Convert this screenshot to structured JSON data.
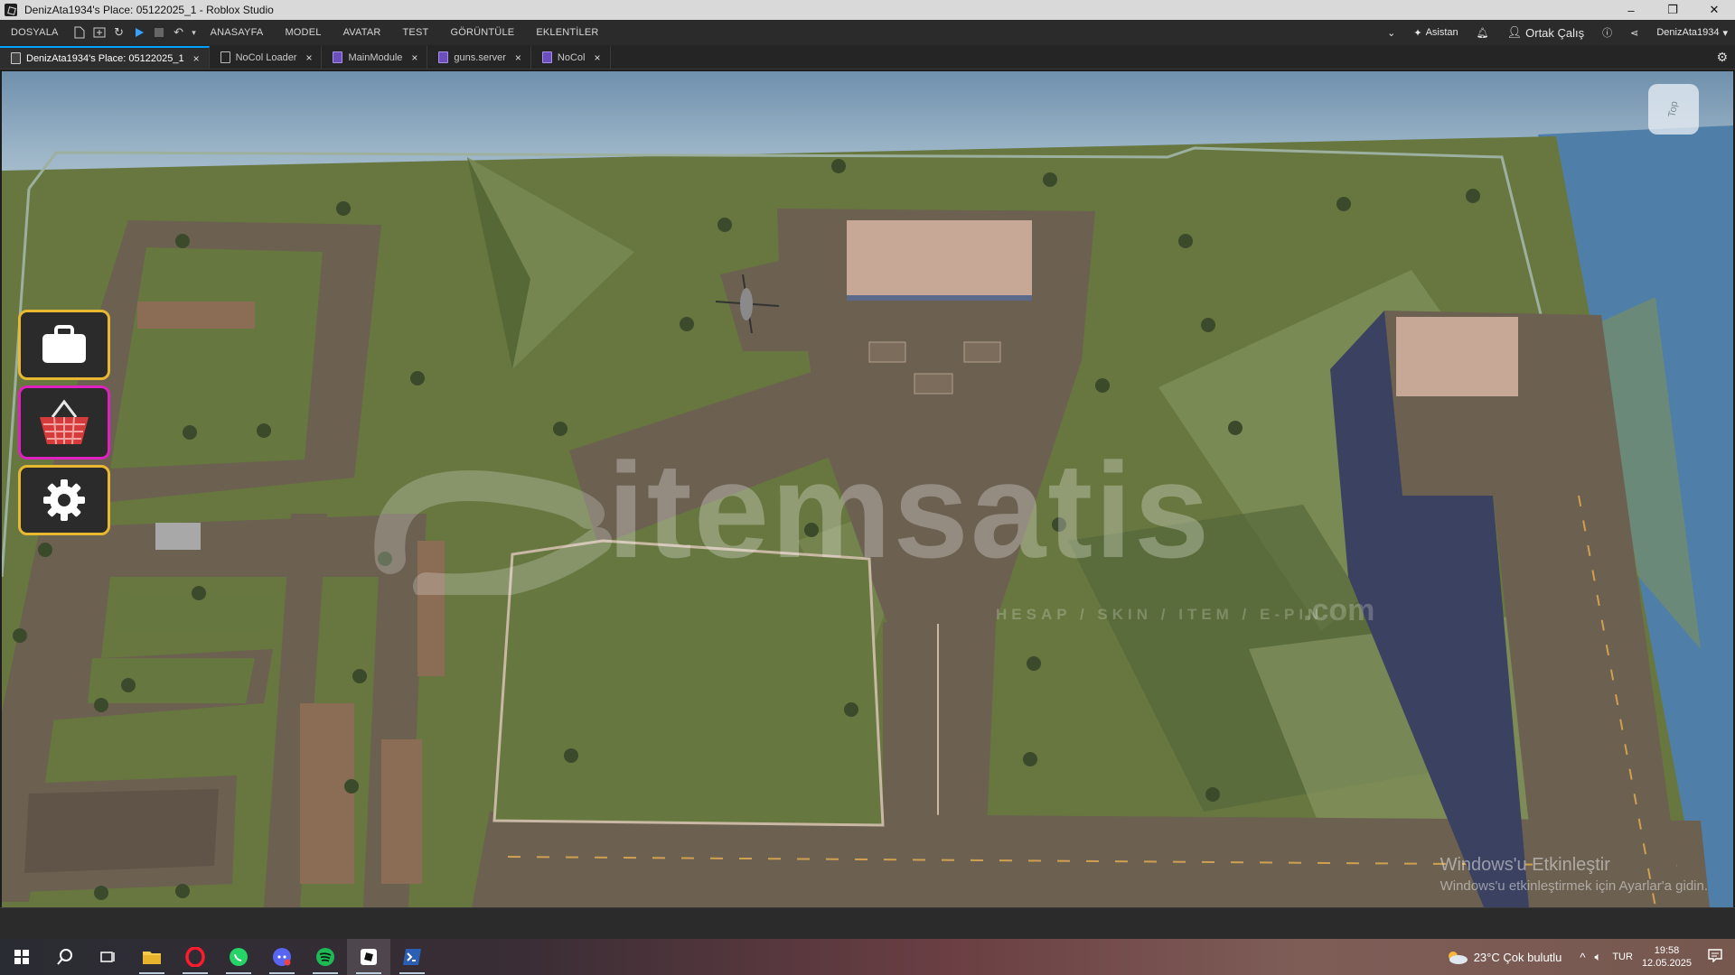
{
  "window": {
    "title": "DenizAta1934's Place: 05122025_1 - Roblox Studio",
    "controls": [
      "–",
      "❐",
      "✕"
    ]
  },
  "menubar": {
    "file": "DOSYALA",
    "tabs": [
      "ANASAYFA",
      "MODEL",
      "AVATAR",
      "TEST",
      "GÖRÜNTÜLE",
      "EKLENTİLER"
    ],
    "assistant": "Asistan",
    "collaborate": "Ortak Çalış",
    "username": "DenizAta1934"
  },
  "tabs": [
    {
      "label": "DenizAta1934's Place: 05122025_1",
      "kind": "place",
      "active": true
    },
    {
      "label": "NoCol Loader",
      "kind": "doc",
      "active": false
    },
    {
      "label": "MainModule",
      "kind": "script",
      "active": false
    },
    {
      "label": "guns.server",
      "kind": "script",
      "active": false
    },
    {
      "label": "NoCol",
      "kind": "script",
      "active": false
    }
  ],
  "viewport": {
    "viewcube_label": "Top",
    "watermark": {
      "brand": "itemsatis",
      "tagline": "HESAP / SKIN / ITEM / E-PIN",
      "domain": ".com"
    },
    "activation": {
      "line1": "Windows'u Etkinleştir",
      "line2": "Windows'u etkinleştirmek için Ayarlar'a gidin."
    },
    "side_buttons": {
      "bag_border": "#e8b830",
      "shop_border": "#e020c0",
      "settings_border": "#e8b830"
    }
  },
  "taskbar": {
    "apps": [
      "windows-start",
      "search",
      "task-view",
      "file-explorer",
      "opera",
      "whatsapp",
      "discord",
      "spotify",
      "roblox-studio",
      "powershell"
    ],
    "weather": "23°C  Çok bulutlu",
    "language": "TUR",
    "time": "19:58",
    "date": "12.05.2025"
  }
}
